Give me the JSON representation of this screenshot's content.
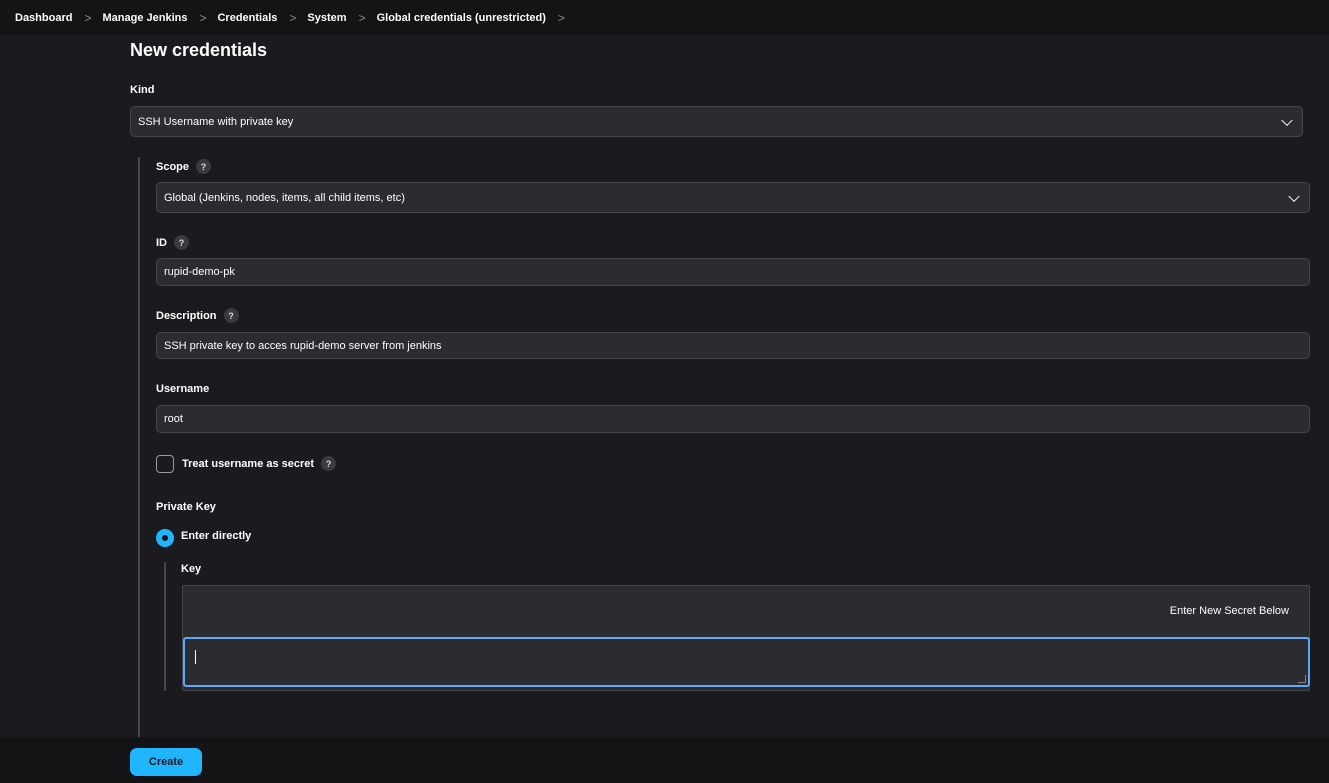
{
  "breadcrumb": [
    {
      "label": "Dashboard"
    },
    {
      "label": "Manage Jenkins"
    },
    {
      "label": "Credentials"
    },
    {
      "label": "System"
    },
    {
      "label": "Global credentials (unrestricted)"
    }
  ],
  "breadcrumb_separator": ">",
  "page": {
    "title": "New credentials"
  },
  "form": {
    "kind_label": "Kind",
    "kind_value": "SSH Username with private key",
    "scope_label": "Scope",
    "scope_value": "Global (Jenkins, nodes, items, all child items, etc)",
    "id_label": "ID",
    "id_value": "rupid-demo-pk",
    "description_label": "Description",
    "description_value": "SSH private key to acces rupid-demo server from jenkins",
    "username_label": "Username",
    "username_value": "root",
    "treat_secret_label": "Treat username as secret",
    "treat_secret_checked": false,
    "private_key_label": "Private Key",
    "enter_directly_label": "Enter directly",
    "key_label": "Key",
    "secret_hint": "Enter New Secret Below",
    "key_value": "",
    "help_glyph": "?"
  },
  "actions": {
    "create_label": "Create"
  },
  "colors": {
    "accent": "#1fb6ff",
    "background": "#1b1b1f",
    "field": "#2b2b30"
  }
}
